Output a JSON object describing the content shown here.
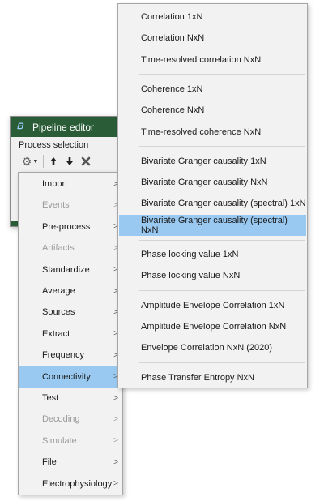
{
  "window": {
    "title": "Pipeline editor",
    "section_label": "Process selection",
    "colors": {
      "titlebar": "#2a5c38",
      "highlight": "#99c9f1"
    }
  },
  "toolbar": {
    "icons": [
      "gear-icon",
      "arrow-up-icon",
      "arrow-down-icon",
      "delete-icon"
    ],
    "gear_glyph": "⚙",
    "caret_glyph": "▼",
    "up_glyph": "🠉",
    "down_glyph": "🠋",
    "delete_glyph": "✖"
  },
  "menu": {
    "arrow_glyph": ">",
    "items": [
      {
        "label": "Import",
        "disabled": false
      },
      {
        "label": "Events",
        "disabled": true
      },
      {
        "label": "Pre-process",
        "disabled": false
      },
      {
        "label": "Artifacts",
        "disabled": true
      },
      {
        "label": "Standardize",
        "disabled": false
      },
      {
        "label": "Average",
        "disabled": false
      },
      {
        "label": "Sources",
        "disabled": false
      },
      {
        "label": "Extract",
        "disabled": false
      },
      {
        "label": "Frequency",
        "disabled": false
      },
      {
        "label": "Connectivity",
        "disabled": false,
        "active": true
      },
      {
        "label": "Test",
        "disabled": false
      },
      {
        "label": "Decoding",
        "disabled": true
      },
      {
        "label": "Simulate",
        "disabled": true
      },
      {
        "label": "File",
        "disabled": false
      },
      {
        "label": "Electrophysiology",
        "disabled": false
      }
    ]
  },
  "submenu": {
    "items": [
      "Correlation 1xN",
      "Correlation NxN",
      "Time-resolved correlation NxN",
      "Coherence 1xN",
      "Coherence NxN",
      "Time-resolved coherence NxN",
      "Bivariate Granger causality 1xN",
      "Bivariate Granger causality NxN",
      "Bivariate Granger causality (spectral) 1xN",
      "Bivariate Granger causality (spectral) NxN",
      "Phase locking value 1xN",
      "Phase locking value NxN",
      "Amplitude Envelope Correlation 1xN",
      "Amplitude Envelope Correlation NxN",
      "Envelope Correlation NxN (2020)",
      "Phase Transfer Entropy NxN"
    ],
    "active": "Bivariate Granger causality (spectral) NxN"
  }
}
